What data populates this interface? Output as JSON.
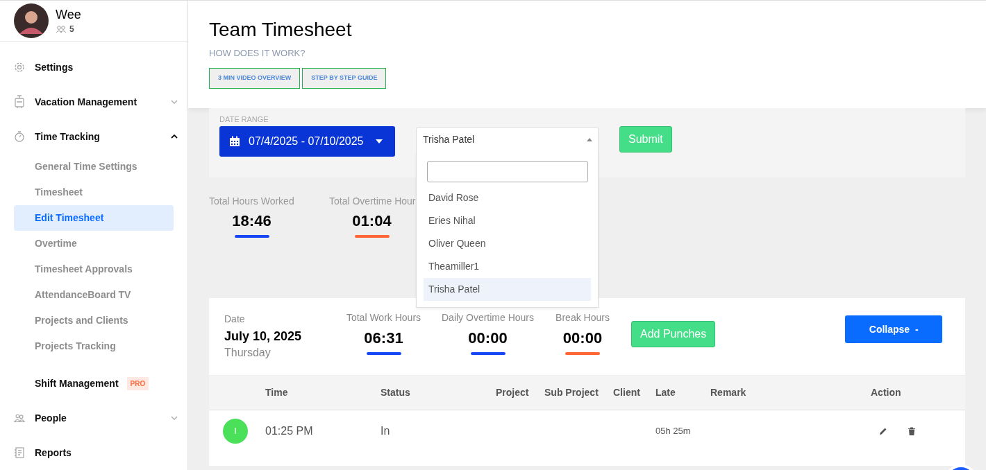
{
  "user": {
    "name": "Wee",
    "team_count": "5"
  },
  "nav": [
    {
      "kind": "item",
      "label": "Settings"
    },
    {
      "kind": "group",
      "label": "Vacation Management",
      "expanded": false
    },
    {
      "kind": "group",
      "label": "Time Tracking",
      "expanded": true,
      "children": [
        {
          "label": "General Time Settings",
          "selected": false
        },
        {
          "label": "Timesheet",
          "selected": false
        },
        {
          "label": "Edit Timesheet",
          "selected": true
        },
        {
          "label": "Overtime",
          "selected": false
        },
        {
          "label": "Timesheet Approvals",
          "selected": false
        },
        {
          "label": "AttendanceBoard TV",
          "selected": false
        },
        {
          "label": "Projects and Clients",
          "selected": false
        },
        {
          "label": "Projects Tracking",
          "selected": false
        }
      ]
    },
    {
      "kind": "badge",
      "label": "Shift Management",
      "badge": "PRO"
    },
    {
      "kind": "group",
      "label": "People",
      "expanded": false
    },
    {
      "kind": "item",
      "label": "Reports"
    }
  ],
  "page": {
    "title": "Team Timesheet",
    "subtitle": "HOW DOES IT WORK?",
    "help_buttons": [
      "3 MIN VIDEO OVERVIEW",
      "STEP BY STEP GUIDE"
    ]
  },
  "filters": {
    "date_label": "DATE RANGE",
    "date_range": "07/4/2025 - 07/10/2025",
    "employee": {
      "value": "Trisha Patel",
      "expanded": true,
      "options": [
        {
          "label": "David Rose",
          "selected": false
        },
        {
          "label": "Eries Nihal",
          "selected": false
        },
        {
          "label": "Oliver Queen",
          "selected": false
        },
        {
          "label": "Theamiller1",
          "selected": false
        },
        {
          "label": "Trisha Patel",
          "selected": true
        }
      ]
    },
    "submit": "Submit"
  },
  "totals": [
    {
      "label": "Total Hours Worked",
      "value": "18:46",
      "color": "#1747f5"
    },
    {
      "label": "Total Overtime Hour",
      "value": "01:04",
      "color": "#ff6633"
    }
  ],
  "day": {
    "date_label": "Date",
    "date": "July 10, 2025",
    "weekday": "Thursday",
    "metrics": [
      {
        "label": "Total Work Hours",
        "value": "06:31",
        "color": "#1747f5"
      },
      {
        "label": "Daily Overtime Hours",
        "value": "00:00",
        "color": "#1747f5"
      },
      {
        "label": "Break Hours",
        "value": "00:00",
        "color": "#ff6633"
      }
    ],
    "add_button": "Add Punches",
    "collapse_button": "Collapse  -",
    "table": {
      "columns": [
        "Time",
        "Status",
        "Project",
        "Sub Project",
        "Client",
        "Late",
        "Remark",
        "Action"
      ],
      "rows": [
        {
          "initial": "I",
          "time": "01:25 PM",
          "status": "In",
          "late": "05h 25m"
        }
      ]
    }
  }
}
